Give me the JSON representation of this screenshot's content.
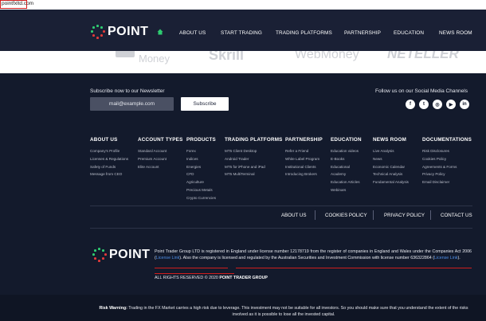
{
  "browser": {
    "url": "pointfxltd.com"
  },
  "header": {
    "brand": "POINT",
    "nav": [
      "ABOUT US",
      "START TRADING",
      "TRADING PLATFORMS",
      "PARTNERSHIP",
      "EDUCATION",
      "NEWS ROOM"
    ]
  },
  "partners": [
    "Money",
    "Skrill",
    "WebMoney",
    "NETELLER"
  ],
  "newsletter": {
    "label": "Subscribe now to our Newsletter",
    "placeholder": "mail@example.com",
    "button": "Subscribe"
  },
  "social": {
    "label": "Follow us on our Social Media Channels",
    "icons": [
      "facebook-icon",
      "twitter-icon",
      "instagram-icon",
      "youtube-icon",
      "linkedin-icon"
    ],
    "glyphs": [
      "f",
      "t",
      "◎",
      "▶",
      "in"
    ]
  },
  "columns": [
    {
      "heading": "ABOUT US",
      "items": [
        "Company's Profile",
        "Licenses & Regulations",
        "Safety of Funds",
        "Message from CEO"
      ]
    },
    {
      "heading": "ACCOUNT TYPES",
      "items": [
        "Standard Account",
        "Premium Account",
        "Elite Account"
      ]
    },
    {
      "heading": "PRODUCTS",
      "items": [
        "Forex",
        "Indices",
        "Energies",
        "CFD",
        "Agriculture",
        "Precious Metals",
        "Crypto Currencies"
      ]
    },
    {
      "heading": "TRADING PLATFORMS",
      "items": [
        "MT5 Client Desktop",
        "Android Trader",
        "MT5 for iPhone and iPad",
        "MT5 MultiTerminal"
      ]
    },
    {
      "heading": "PARTNERSHIP",
      "items": [
        "Refer a Friend",
        "White Label Program",
        "Institutional Clients",
        "Introducing Brokers"
      ]
    },
    {
      "heading": "EDUCATION",
      "items": [
        "Education videos",
        "E-Books",
        "Educational",
        "Academy",
        "Education Articles",
        "Webinars"
      ]
    },
    {
      "heading": "NEWS ROOM",
      "items": [
        "Live Analysis",
        "News",
        "Economic Calendar",
        "Technical Analysis",
        "Fundamental Analysis"
      ]
    },
    {
      "heading": "DOCUMENTATIONS",
      "items": [
        "Risk Disclosures",
        "Cookies Policy",
        "Agreements & Forms",
        "Privacy Policy",
        "Email Disclaimer"
      ]
    }
  ],
  "bottom_links": [
    "ABOUT US",
    "COOKIES POLICY",
    "PRIVACY POLICY",
    "CONTACT US"
  ],
  "legal": {
    "part1": "Point Trader Group LTD is registered in England under license number 12178719 from the register of companies in England and Wales under the Companies Act 2006 (",
    "link1": "License Link",
    "part2": "). Also the company is licensed and regulated by the Australian Securities and Investment Commission with license number 636322864 (",
    "link2": "License Link",
    "part3": ").",
    "rights_prefix": "ALL RIGHTS RESERVED © 2020 ",
    "rights_company": "POINT TRADER GROUP"
  },
  "risk": {
    "label": "Risk Warning:",
    "text": " Trading in the FX Market carries a high risk due to leverage. This investment may not be suitable for all investors. So you should make sure that you understand the extent of the risks involved as it is possible to lose all the invested capital."
  },
  "colors": {
    "background": "#131a2c",
    "nav": "#1a2035",
    "accent_green": "#2ecc71",
    "accent_red": "#e03a3a",
    "link": "#4f8fe6"
  }
}
